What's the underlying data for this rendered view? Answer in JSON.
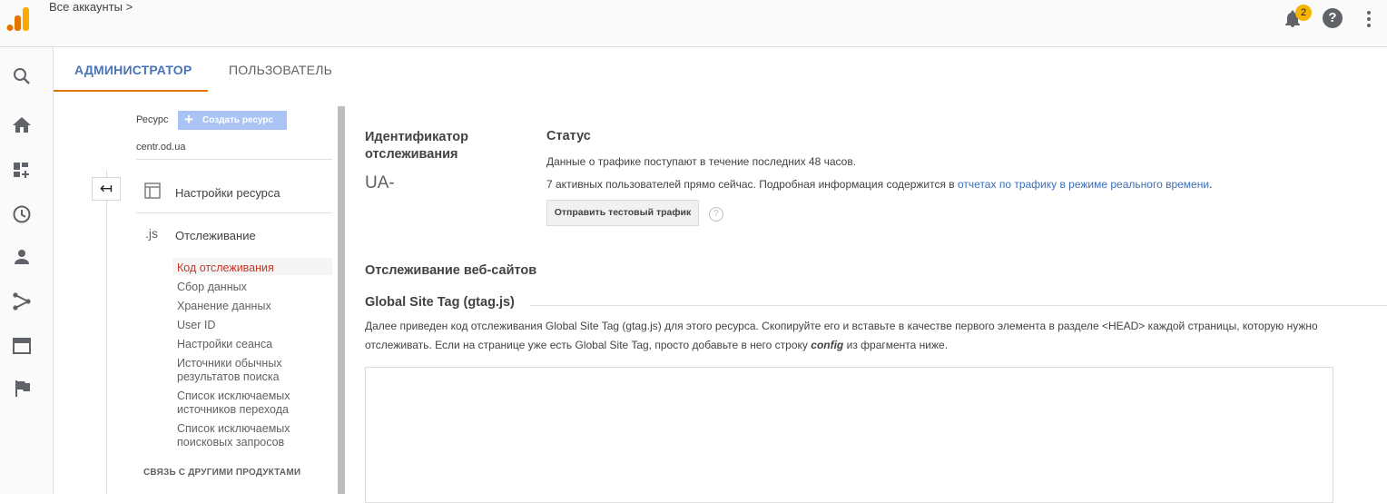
{
  "header": {
    "breadcrumb": "Все аккаунты",
    "breadcrumb_chevron": ">",
    "notification_count": "2"
  },
  "leftnav": {
    "icons": [
      "search-icon",
      "home-icon",
      "customization-icon",
      "realtime-icon",
      "audience-icon",
      "acquisition-icon",
      "behavior-icon",
      "conversions-icon"
    ]
  },
  "tabs": {
    "admin": "АДМИНИСТРАТОР",
    "user": "ПОЛЬЗОВАТЕЛЬ"
  },
  "property": {
    "label": "Ресурс",
    "create_button": "Создать ресурс",
    "name": "centr.od.ua",
    "settings": "Настройки ресурса",
    "js_icon_text": ".js",
    "tracking": "Отслеживание",
    "subitems": [
      "Код отслеживания",
      "Сбор данных",
      "Хранение данных",
      "User ID",
      "Настройки сеанса",
      "Источники обычных результатов поиска",
      "Список исключаемых источников перехода",
      "Список исключаемых поисковых запросов"
    ],
    "related": "СВЯЗЬ С ДРУГИМИ ПРОДУКТАМИ"
  },
  "main": {
    "tracking_id_title": "Идентификатор отслеживания",
    "tracking_id_value": "UA-",
    "status_title": "Статус",
    "status_line1": "Данные о трафике поступают в течение последних 48 часов.",
    "status_line2_prefix": "7 активных пользователей прямо сейчас. Подробная информация содержится в",
    "status_line2_link": "отчетах по трафику в режиме реального времени",
    "status_line2_suffix": ".",
    "test_button": "Отправить тестовый трафик",
    "help_mark": "?",
    "web_tracking_title": "Отслеживание веб-сайтов",
    "gtag_title": "Global Site Tag (gtag.js)",
    "desc_part1": "Далее приведен код отслеживания Global Site Tag (gtag.js) для этого ресурса. Скопируйте его и вставьте в качестве первого элемента в разделе <HEAD> каждой страницы, которую нужно отслеживать. Если на странице уже есть Global Site Tag, просто добавьте в него строку",
    "desc_bold": "config",
    "desc_part2": "из фрагмента ниже."
  },
  "colors": {
    "accent_orange": "#e37400",
    "active_tab_text": "#4a74b8",
    "active_item": "#c53929",
    "badge": "#f4b400",
    "link": "#3c6fb6"
  }
}
